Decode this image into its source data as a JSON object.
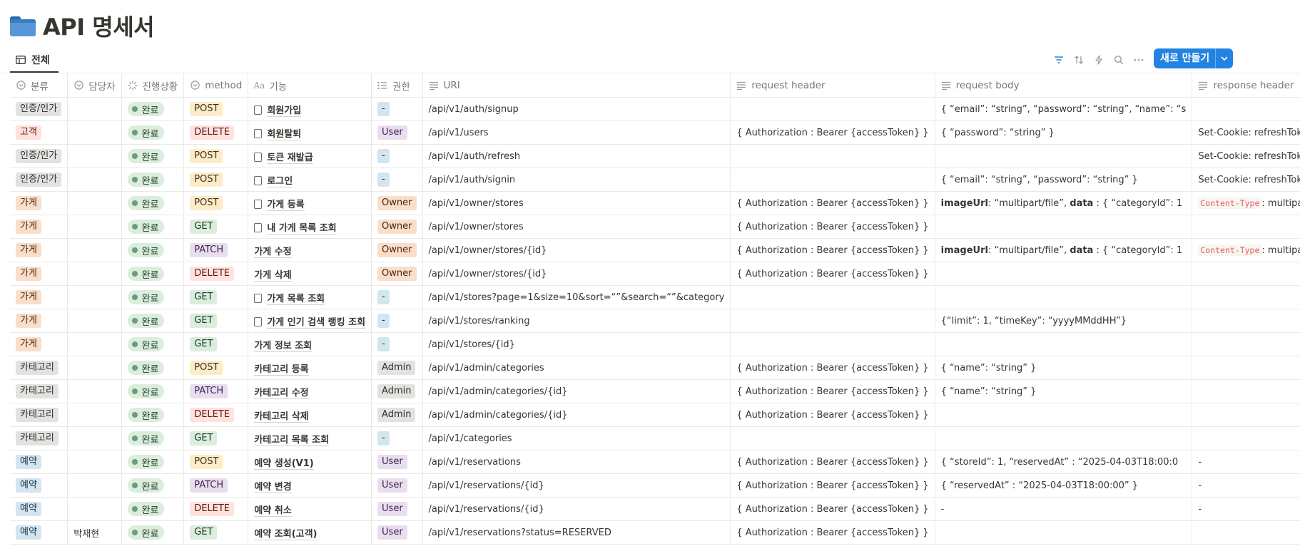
{
  "page": {
    "title": "API 명세서"
  },
  "view": {
    "tab_label": "전체"
  },
  "toolbar": {
    "new_button_label": "새로 만들기"
  },
  "columns": [
    {
      "label": "분류",
      "icon": "select-icon"
    },
    {
      "label": "담당자",
      "icon": "select-icon"
    },
    {
      "label": "진행상황",
      "icon": "status-icon"
    },
    {
      "label": "method",
      "icon": "select-icon"
    },
    {
      "label": "기능",
      "icon": "title-icon"
    },
    {
      "label": "권한",
      "icon": "multiselect-icon"
    },
    {
      "label": "URI",
      "icon": "text-icon"
    },
    {
      "label": "request header",
      "icon": "text-icon"
    },
    {
      "label": "request body",
      "icon": "text-icon"
    },
    {
      "label": "response header",
      "icon": "text-icon"
    }
  ],
  "colors": {
    "category": {
      "인증/인가": [
        "#e3e2e0",
        "#32302c"
      ],
      "고객": [
        "#ffe2dd",
        "#5d1715"
      ],
      "가게": [
        "#fadec9",
        "#49290e"
      ],
      "카테고리": [
        "#e3e2e0",
        "#32302c"
      ],
      "예약": [
        "#d3e5ef",
        "#183347"
      ]
    },
    "method": {
      "POST": [
        "#fdecc8",
        "#402c1b"
      ],
      "DELETE": [
        "#ffe2dd",
        "#5d1715"
      ],
      "GET": [
        "#dbeddb",
        "#1c3829"
      ],
      "PATCH": [
        "#e8deee",
        "#412454"
      ]
    },
    "role": {
      "-": [
        "#d3e5ef",
        "#183347"
      ],
      "User": [
        "#e8deee",
        "#412454"
      ],
      "Owner": [
        "#fadec9",
        "#49290e"
      ],
      "Admin": [
        "#e3e2e0",
        "#32302c"
      ]
    }
  },
  "rows": [
    {
      "category": "인증/인가",
      "assignee": "",
      "status": "완료",
      "method": "POST",
      "doc": true,
      "feature": "회원가입",
      "role": "-",
      "uri": "/api/v1/auth/signup",
      "req_header": "",
      "req_body": "{ “email”: “string”, “password”: “string”, “name”: “s",
      "res_header": ""
    },
    {
      "category": "고객",
      "assignee": "",
      "status": "완료",
      "method": "DELETE",
      "doc": true,
      "feature": "회원탈퇴",
      "role": "User",
      "uri": "/api/v1/users",
      "req_header": "{ Authorization : Bearer {accessToken} }",
      "req_body": "{ “password”: “string” }",
      "res_header": "Set-Cookie: refreshToken=“”"
    },
    {
      "category": "인증/인가",
      "assignee": "",
      "status": "완료",
      "method": "POST",
      "doc": true,
      "feature": "토큰 재발급",
      "role": "-",
      "uri": "/api/v1/auth/refresh",
      "req_header": "",
      "req_body": "",
      "res_header": "Set-Cookie: refreshToken={r"
    },
    {
      "category": "인증/인가",
      "assignee": "",
      "status": "완료",
      "method": "POST",
      "doc": true,
      "feature": "로그인",
      "role": "-",
      "uri": "/api/v1/auth/signin",
      "req_header": "",
      "req_body": "{ “email”: “string”, “password”: “string” }",
      "res_header": "Set-Cookie: refreshToken={r"
    },
    {
      "category": "가게",
      "assignee": "",
      "status": "완료",
      "method": "POST",
      "doc": true,
      "feature": "가게 등록",
      "role": "Owner",
      "uri": "/api/v1/owner/stores",
      "req_header": "{ Authorization : Bearer {accessToken} }",
      "req_body_rich": [
        "imageUrl",
        ": “multipart/file”, ",
        "data",
        " : { “categoryId”: 1"
      ],
      "res_code": "Content-Type",
      "res_header": ": multipart/for"
    },
    {
      "category": "가게",
      "assignee": "",
      "status": "완료",
      "method": "GET",
      "doc": true,
      "feature": "내 가게 목록 조회",
      "role": "Owner",
      "uri": "/api/v1/owner/stores",
      "req_header": "{ Authorization : Bearer {accessToken} }",
      "req_body": "",
      "res_header": ""
    },
    {
      "category": "가게",
      "assignee": "",
      "status": "완료",
      "method": "PATCH",
      "doc": false,
      "feature": "가게 수정",
      "role": "Owner",
      "uri": "/api/v1/owner/stores/{id}",
      "req_header": "{ Authorization : Bearer {accessToken} }",
      "req_body_rich": [
        "imageUrl",
        ": “multipart/file”, ",
        "data",
        " : { “categoryId”: 1"
      ],
      "res_code": "Content-Type",
      "res_header": ": multipart/for"
    },
    {
      "category": "가게",
      "assignee": "",
      "status": "완료",
      "method": "DELETE",
      "doc": false,
      "feature": "가게 삭제",
      "role": "Owner",
      "uri": "/api/v1/owner/stores/{id}",
      "req_header": "{ Authorization : Bearer {accessToken} }",
      "req_body": "",
      "res_header": ""
    },
    {
      "category": "가게",
      "assignee": "",
      "status": "완료",
      "method": "GET",
      "doc": true,
      "feature": "가게 목록 조회",
      "role": "-",
      "uri": "/api/v1/stores?page=1&size=10&sort=“”&search=“”&category",
      "req_header": "",
      "req_body": "",
      "res_header": ""
    },
    {
      "category": "가게",
      "assignee": "",
      "status": "완료",
      "method": "GET",
      "doc": true,
      "feature": "가게 인기 검색 랭킹 조회",
      "role": "-",
      "uri": "/api/v1/stores/ranking",
      "req_header": "",
      "req_body": "{“limit”: 1, “timeKey”: “yyyyMMddHH”}",
      "res_header": ""
    },
    {
      "category": "가게",
      "assignee": "",
      "status": "완료",
      "method": "GET",
      "doc": false,
      "feature": "가게 정보 조회",
      "role": "-",
      "uri": "/api/v1/stores/{id}",
      "req_header": "",
      "req_body": "",
      "res_header": ""
    },
    {
      "category": "카테고리",
      "assignee": "",
      "status": "완료",
      "method": "POST",
      "doc": false,
      "feature": "카테고리 등록",
      "role": "Admin",
      "uri": "/api/v1/admin/categories",
      "req_header": "{ Authorization : Bearer {accessToken} }",
      "req_body": "{ “name”: “string” }",
      "res_header": ""
    },
    {
      "category": "카테고리",
      "assignee": "",
      "status": "완료",
      "method": "PATCH",
      "doc": false,
      "feature": "카테고리 수정",
      "role": "Admin",
      "uri": "/api/v1/admin/categories/{id}",
      "req_header": "{ Authorization : Bearer {accessToken} }",
      "req_body": "{ “name”: “string” }",
      "res_header": ""
    },
    {
      "category": "카테고리",
      "assignee": "",
      "status": "완료",
      "method": "DELETE",
      "doc": false,
      "feature": "카테고리 삭제",
      "role": "Admin",
      "uri": "/api/v1/admin/categories/{id}",
      "req_header": "{ Authorization : Bearer {accessToken} }",
      "req_body": "",
      "res_header": ""
    },
    {
      "category": "카테고리",
      "assignee": "",
      "status": "완료",
      "method": "GET",
      "doc": false,
      "feature": "카테고리 목록 조회",
      "role": "-",
      "uri": "/api/v1/categories",
      "req_header": "",
      "req_body": "",
      "res_header": ""
    },
    {
      "category": "예약",
      "assignee": "",
      "status": "완료",
      "method": "POST",
      "doc": false,
      "feature": "예약 생성(V1)",
      "role": "User",
      "uri": "/api/v1/reservations",
      "req_header": "{ Authorization : Bearer {accessToken} }",
      "req_body": "{ “storeId”: 1, “reservedAt” : “2025-04-03T18:00:0",
      "res_header": "-"
    },
    {
      "category": "예약",
      "assignee": "",
      "status": "완료",
      "method": "PATCH",
      "doc": false,
      "feature": "예약 변경",
      "role": "User",
      "uri": "/api/v1/reservations/{id}",
      "req_header": "{ Authorization : Bearer {accessToken} }",
      "req_body": "{ “reservedAt” : “2025-04-03T18:00:00” }",
      "res_header": "-"
    },
    {
      "category": "예약",
      "assignee": "",
      "status": "완료",
      "method": "DELETE",
      "doc": false,
      "feature": "예약 취소",
      "role": "User",
      "uri": "/api/v1/reservations/{id}",
      "req_header": "{ Authorization : Bearer {accessToken} }",
      "req_body": "-",
      "res_header": "-"
    },
    {
      "category": "예약",
      "assignee": "박재현",
      "status": "완료",
      "method": "GET",
      "doc": false,
      "feature": "예약 조회(고객)",
      "role": "User",
      "uri": "/api/v1/reservations?status=RESERVED",
      "req_header": "{ Authorization : Bearer {accessToken} }",
      "req_body": "",
      "res_header": ""
    }
  ]
}
